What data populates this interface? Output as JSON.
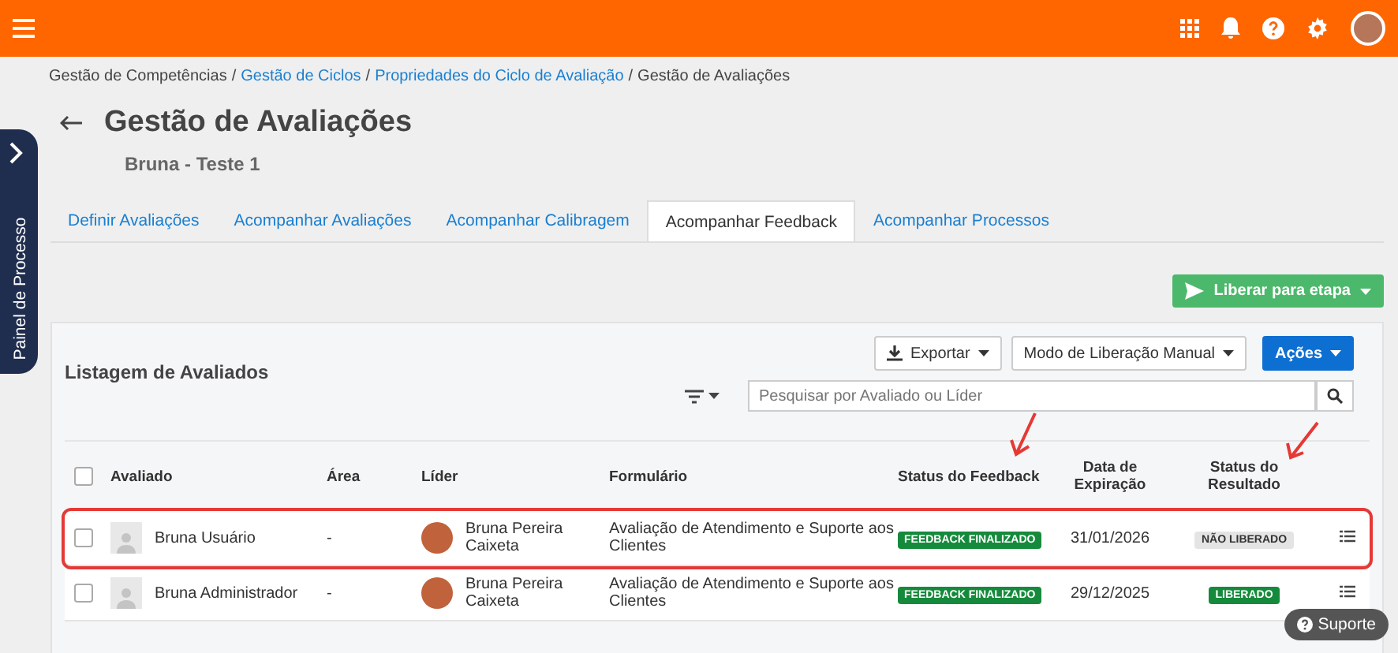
{
  "breadcrumb": [
    {
      "label": "Gestão de Competências",
      "link": false
    },
    {
      "label": "Gestão de Ciclos",
      "link": true
    },
    {
      "label": "Propriedades do Ciclo de Avaliação",
      "link": true
    },
    {
      "label": "Gestão de Avaliações",
      "link": false
    }
  ],
  "breadcrumb_separator": "/",
  "page": {
    "title": "Gestão de Avaliações",
    "subtitle": "Bruna - Teste 1"
  },
  "side_panel": {
    "label": "Painel de Processo"
  },
  "tabs": [
    {
      "label": "Definir Avaliações",
      "selected": false
    },
    {
      "label": "Acompanhar Avaliações",
      "selected": false
    },
    {
      "label": "Acompanhar Calibragem",
      "selected": false
    },
    {
      "label": "Acompanhar Feedback",
      "selected": true
    },
    {
      "label": "Acompanhar Processos",
      "selected": false
    }
  ],
  "primary_action": "Liberar para etapa",
  "list": {
    "title": "Listagem de Avaliados",
    "buttons": [
      {
        "label": "Exportar",
        "kind": "export"
      },
      {
        "label": "Modo de Liberação Manual",
        "kind": "plain"
      },
      {
        "label": "Ações",
        "kind": "primary"
      }
    ],
    "search": {
      "placeholder": "Pesquisar por Avaliado ou Líder"
    },
    "select_all_checked": false,
    "columns": [
      "Avaliado",
      "Área",
      "Líder",
      "Formulário",
      "Status do Feedback",
      "Data de Expiração",
      "Status do Resultado"
    ],
    "rows": [
      {
        "checked": false,
        "highlighted": true,
        "evaluated": "Bruna Usuário",
        "area": "-",
        "leader": "Bruna Pereira Caixeta",
        "form": "Avaliação de Atendimento e Suporte aos Clientes",
        "feedback_status": {
          "label": "FEEDBACK FINALIZADO",
          "kind": "done"
        },
        "expiration": "31/01/2026",
        "result_status": {
          "label": "NÃO LIBERADO",
          "kind": "pending"
        }
      },
      {
        "checked": false,
        "highlighted": false,
        "evaluated": "Bruna Administrador",
        "area": "-",
        "leader": "Bruna Pereira Caixeta",
        "form": "Avaliação de Atendimento e Suporte aos Clientes",
        "feedback_status": {
          "label": "FEEDBACK FINALIZADO",
          "kind": "done"
        },
        "expiration": "29/12/2025",
        "result_status": {
          "label": "LIBERADO",
          "kind": "done"
        }
      }
    ]
  },
  "support_button": "Suporte"
}
